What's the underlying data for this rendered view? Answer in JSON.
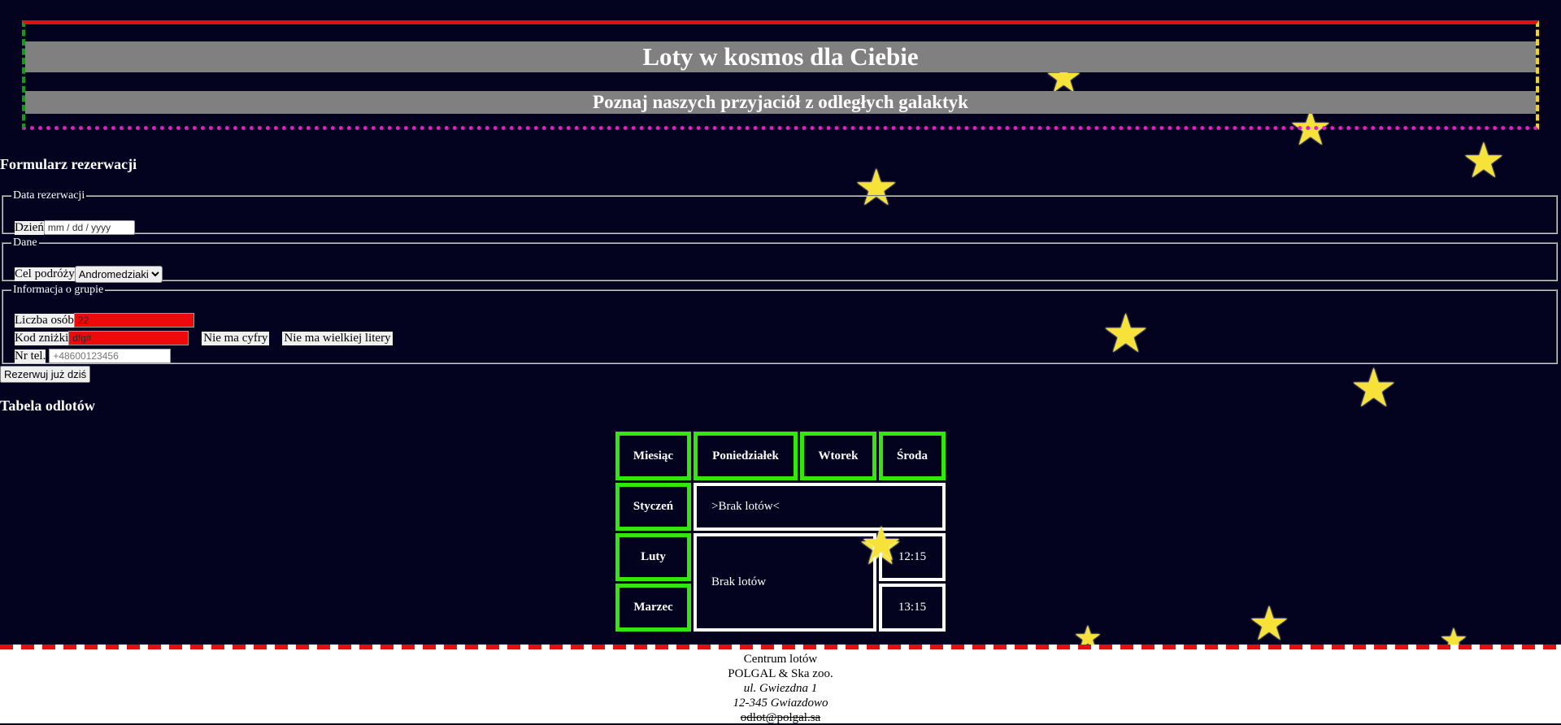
{
  "header": {
    "title": "Loty w kosmos dla Ciebie",
    "subtitle": "Poznaj naszych przyjaciół z odległych galaktyk"
  },
  "form": {
    "title": "Formularz rezerwacji",
    "fieldset_date": {
      "legend": "Data rezerwacji",
      "day_label": "Dzień",
      "date_placeholder": "mm / dd / yyyy"
    },
    "fieldset_data": {
      "legend": "Dane",
      "destination_label": "Cel podróży",
      "destination_value": "Andromedziaki"
    },
    "fieldset_group": {
      "legend": "Informacja o grupie",
      "people_label": "Liczba osób",
      "people_value": "22",
      "code_label": "Kod zniżki",
      "code_value": "dfg#",
      "code_error_digit": "Nie ma cyfry",
      "code_error_upper": "Nie ma wielkiej litery",
      "phone_label": "Nr tel.",
      "phone_placeholder": "+48600123456"
    },
    "submit_label": "Rezerwuj już dziś"
  },
  "departures": {
    "title": "Tabela odlotów",
    "headers": [
      "Miesiąc",
      "Poniedziałek",
      "Wtorek",
      "Środa"
    ],
    "rows": [
      {
        "month": "Styczeń",
        "info": ">Brak lotów<"
      },
      {
        "month": "Luty",
        "info": "Brak lotów",
        "time": "12:15"
      },
      {
        "month": "Marzec",
        "time": "13:15"
      }
    ]
  },
  "footer": {
    "line1": "Centrum lotów",
    "line2": "POLGAL & Ska zoo.",
    "line3": "ul. Gwiezdna 1",
    "line4": "12-345 Gwiazdowo",
    "email": "odlot@polgal.sa"
  },
  "colors": {
    "background": "#03021f",
    "header_band": "#808080",
    "table_header_border": "#33e60c",
    "invalid_input": "#ee0a0a",
    "star": "#f7e23a"
  }
}
